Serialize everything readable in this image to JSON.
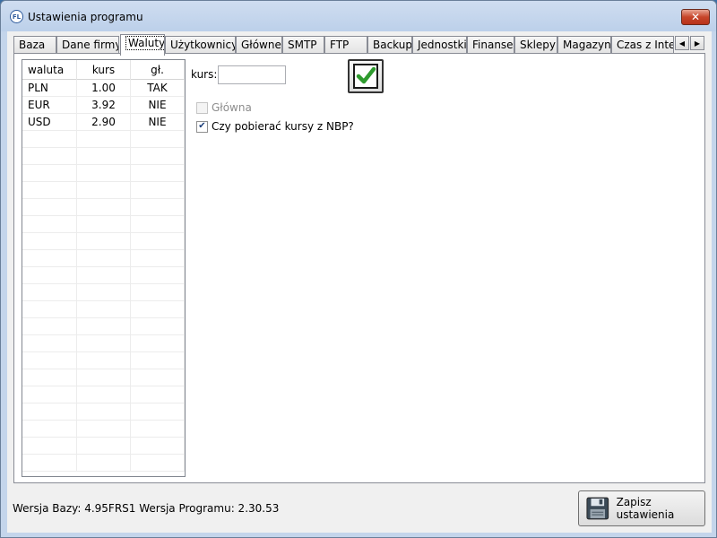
{
  "window": {
    "title": "Ustawienia programu",
    "app_icon_text": "FL",
    "close_glyph": "✕"
  },
  "tabs": [
    {
      "label": "Baza"
    },
    {
      "label": "Dane firmy"
    },
    {
      "label": "Waluty"
    },
    {
      "label": "Użytkownicy"
    },
    {
      "label": "Główne"
    },
    {
      "label": "SMTP"
    },
    {
      "label": "FTP"
    },
    {
      "label": "Backup"
    },
    {
      "label": "Jednostki"
    },
    {
      "label": "Finanse"
    },
    {
      "label": "Sklepy"
    },
    {
      "label": "Magazyn"
    },
    {
      "label": "Czas z Intern"
    }
  ],
  "active_tab": "Waluty",
  "tab_scroll": {
    "left": "◀",
    "right": "▶"
  },
  "currency_grid": {
    "headers": [
      "waluta",
      "kurs",
      "gł."
    ],
    "rows": [
      [
        "PLN",
        "1.00",
        "TAK"
      ],
      [
        "EUR",
        "3.92",
        "NIE"
      ],
      [
        "USD",
        "2.90",
        "NIE"
      ]
    ]
  },
  "form": {
    "kurs_label": "kurs:",
    "kurs_value": "",
    "ok_icon": "green-checkmark-icon",
    "main_checkbox_label": "Główna",
    "main_checkbox_checked": false,
    "main_checkbox_enabled": false,
    "nbp_checkbox_label": "Czy pobierać kursy z NBP?",
    "nbp_checkbox_checked": true
  },
  "footer": {
    "version_text": "Wersja Bazy: 4.95FRS1 Wersja Programu: 2.30.53",
    "save_label": "Zapisz ustawienia"
  },
  "colors": {
    "check_green": "#2e9b2e",
    "title_bar": "#c4d5eb",
    "close_red": "#c7452a"
  }
}
